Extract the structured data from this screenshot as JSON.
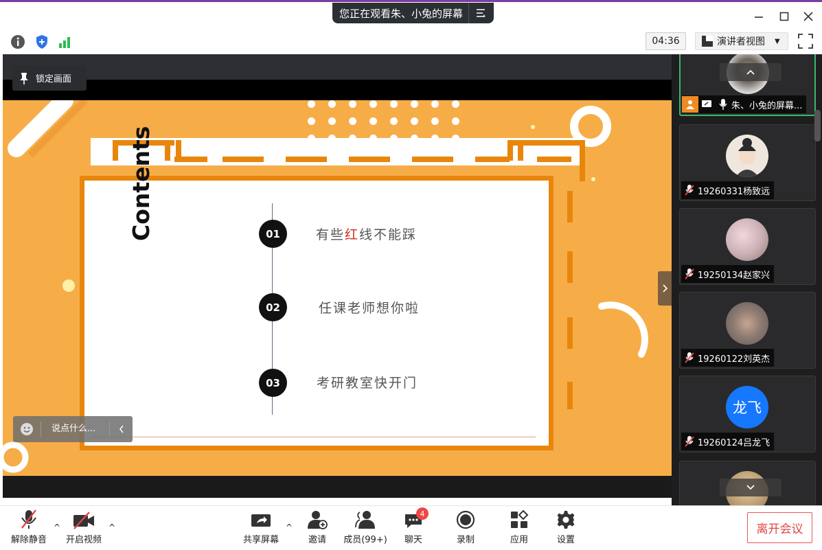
{
  "title_bar": {
    "sharing_notice": "您正在观看朱、小兔的屏幕"
  },
  "info_row": {
    "timer": "04:36",
    "view_mode": "演讲者视图"
  },
  "stage": {
    "lock_label": "锁定画面",
    "chat_placeholder": "说点什么..."
  },
  "slide": {
    "title": "Contents",
    "items": [
      {
        "number": "01",
        "text_before": "有些",
        "text_highlight": "红",
        "text_after": "线不能踩"
      },
      {
        "number": "02",
        "text_before": "任课老师想你啦",
        "text_highlight": "",
        "text_after": ""
      },
      {
        "number": "03",
        "text_before": "考研教室快开门",
        "text_highlight": "",
        "text_after": ""
      }
    ]
  },
  "gallery": {
    "participants": [
      {
        "name": "朱、小兔的屏幕...",
        "avatar": "cat-photo"
      },
      {
        "name": "19260331杨致远",
        "avatar": "cartoon-portrait"
      },
      {
        "name": "19250134赵家兴",
        "avatar": "room-photo"
      },
      {
        "name": "19260122刘英杰",
        "avatar": "person-photo"
      },
      {
        "name": "19260124吕龙飞",
        "avatar_text": "龙飞",
        "avatar_color": "#1677ff"
      }
    ]
  },
  "toolbar": {
    "unmute": "解除静音",
    "start_video": "开启视频",
    "share_screen": "共享屏幕",
    "invite": "邀请",
    "members": "成员(99+)",
    "chat": "聊天",
    "chat_badge": "4",
    "record": "录制",
    "apps": "应用",
    "settings": "设置",
    "leave": "离开会议"
  },
  "colors": {
    "slide_bg": "#f6ad48",
    "slide_accent": "#e8860c",
    "highlight_red": "#d42c1e",
    "active_speaker": "#37b86a",
    "leave_red": "#e24545"
  }
}
